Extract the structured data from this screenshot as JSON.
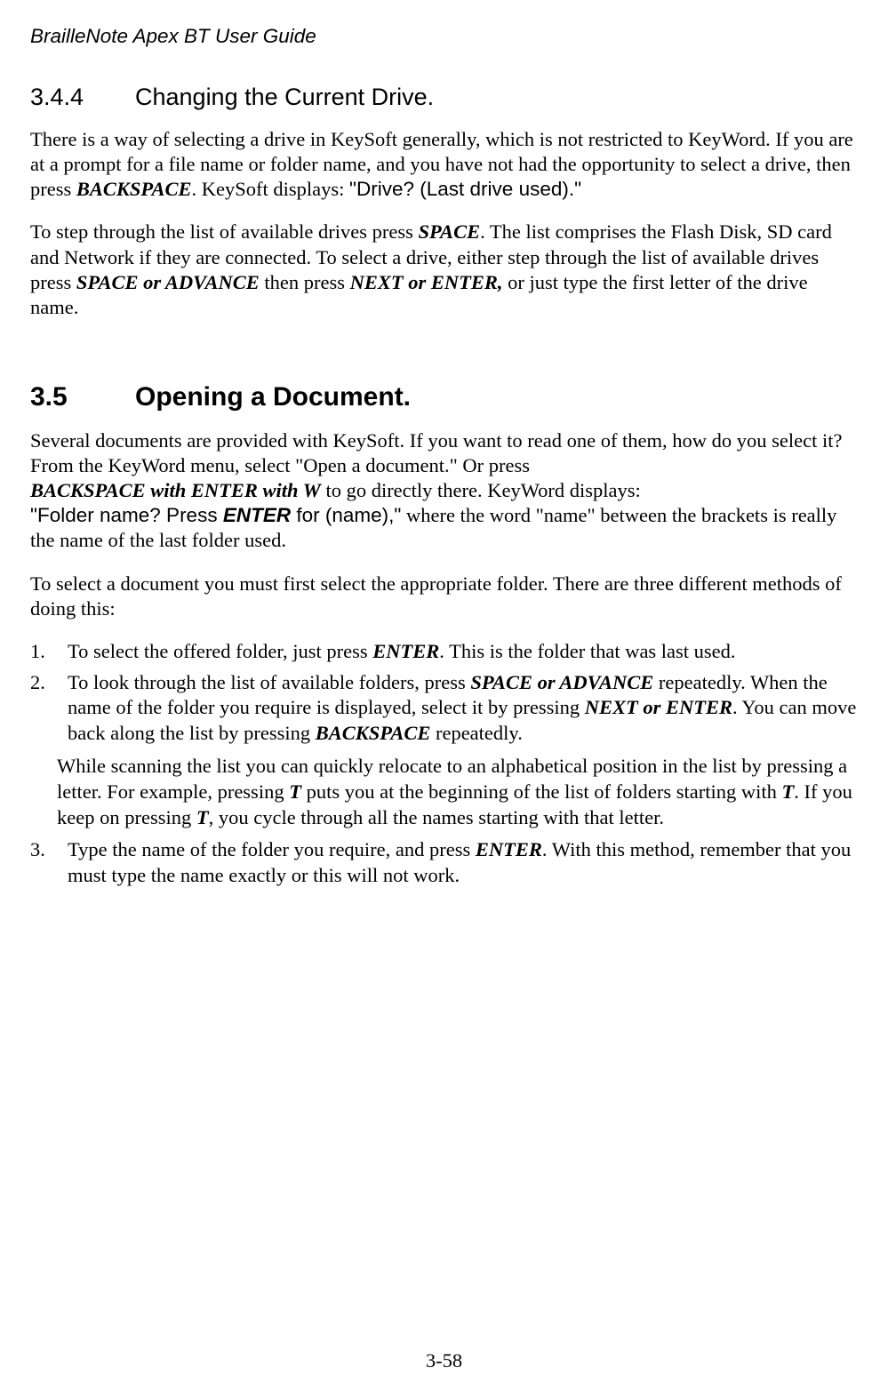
{
  "header": "BrailleNote Apex BT User Guide",
  "section344": {
    "num": "3.4.4",
    "title": "Changing the Current Drive.",
    "p1": {
      "s1": "There is a way of selecting a drive in KeySoft generally, which is not restricted to KeyWord. If you are at a prompt for a file name or folder name, and you have not had the opportunity to select a drive, then press ",
      "k1": "BACKSPACE",
      "s2": ". KeySoft displays: ",
      "d1": "\"Drive? (Last drive used).\""
    },
    "p2": {
      "s1": "To step through the list of available drives press ",
      "k1": "SPACE",
      "s2": ". The list comprises the Flash Disk, SD card and Network if they are connected. To select a drive, either step through the list of available drives press ",
      "k2": "SPACE or ADVANCE",
      "s3": " then press ",
      "k3": "NEXT or ENTER,",
      "s4": " or just type the first letter of the drive name."
    }
  },
  "section35": {
    "num": "3.5",
    "title": "Opening a Document.",
    "p1": {
      "s1": "Several documents are provided with KeySoft. If you want to read one of them, how do you select it? From the KeyWord menu, select \"Open a document.\" Or press ",
      "k1": "BACKSPACE with ENTER with W",
      "s2": " to go directly there. KeyWord displays: ",
      "d1a": "\"Folder name? Press ",
      "d1b": "ENTER",
      "d1c": " for (name),\"",
      "s3": " where the word \"name\" between the brackets is really the name of the last folder used."
    },
    "p2": "To select a document you must first select the appropriate folder. There are three different methods of doing this:",
    "li1": {
      "m": "1.",
      "s1": "To select the offered folder, just press ",
      "k1": "ENTER",
      "s2": ". This is the folder that was last used."
    },
    "li2": {
      "m": "2.",
      "s1": "To look through the list of available folders, press ",
      "k1": "SPACE or ADVANCE",
      "s2": " repeatedly. When the name of the folder you require is displayed, select it by pressing ",
      "k2": "NEXT or ENTER",
      "s3": ". You can move back along the list by pressing ",
      "k3": "BACKSPACE",
      "s4": " repeatedly."
    },
    "sub": {
      "s1": "While scanning the list you can quickly relocate to an alphabetical position in the list by pressing a letter. For example, pressing ",
      "k1": "T",
      "s2": " puts you at the beginning of the list of folders starting with ",
      "k2": "T",
      "s3": ". If you keep on pressing ",
      "k3": "T",
      "s4": ", you cycle through all the names starting with that letter."
    },
    "li3": {
      "m": "3.",
      "s1": "Type the name of the folder  you require, and press ",
      "k1": "ENTER",
      "s2": ". With this method, remember that you must type the name exactly or this will not work."
    }
  },
  "pageNumber": "3-58"
}
